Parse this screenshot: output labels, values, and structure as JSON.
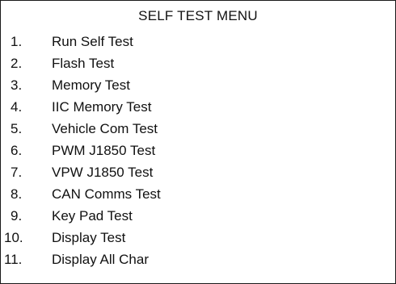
{
  "menu": {
    "title": "SELF TEST MENU",
    "items": [
      {
        "number": "1.",
        "label": "Run Self Test"
      },
      {
        "number": "2.",
        "label": "Flash Test"
      },
      {
        "number": "3.",
        "label": "Memory Test"
      },
      {
        "number": "4.",
        "label": "IIC Memory Test"
      },
      {
        "number": "5.",
        "label": "Vehicle Com Test"
      },
      {
        "number": "6.",
        "label": "PWM J1850 Test"
      },
      {
        "number": "7.",
        "label": "VPW J1850 Test"
      },
      {
        "number": "8.",
        "label": "CAN Comms Test"
      },
      {
        "number": "9.",
        "label": "Key Pad Test"
      },
      {
        "number": "10.",
        "label": "Display Test"
      },
      {
        "number": "11.",
        "label": "Display All Char"
      }
    ]
  },
  "colors": {
    "background": "#ffffff",
    "text": "#111111",
    "border": "#1a1a1a"
  }
}
